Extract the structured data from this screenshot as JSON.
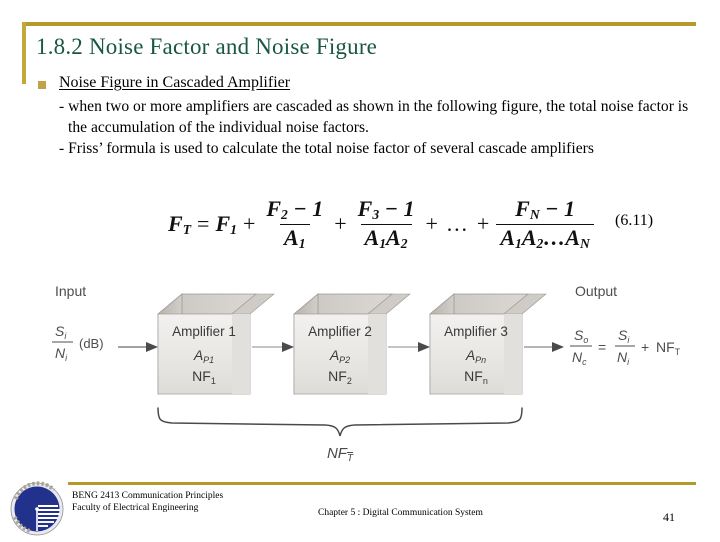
{
  "slide": {
    "title": "1.8.2 Noise Factor and Noise Figure",
    "title_color": "#1a5741",
    "accent_color": "#b5992a",
    "bullet_color": "#c0a24a"
  },
  "bullet": {
    "heading": "Noise Figure in Cascaded Amplifier",
    "paragraphs": [
      "- when two or more amplifiers are cascaded as shown in the following figure, the total noise factor is the accumulation of the individual noise factors.",
      "- Friss’ formula is used to calculate the total noise factor of several cascade amplifiers"
    ]
  },
  "equation": {
    "lhs": "F",
    "lhs_sub": "T",
    "equals": "=",
    "term1": "F",
    "term1_sub": "1",
    "plus": "+",
    "frac1_num_f": "F",
    "frac1_num_sub": "2",
    "frac1_num_tail": "− 1",
    "frac1_den_a": "A",
    "frac1_den_sub": "1",
    "frac2_num_f": "F",
    "frac2_num_sub": "3",
    "frac2_num_tail": "− 1",
    "frac2_den_a1": "A",
    "frac2_den_sub1": "1",
    "frac2_den_a2": "A",
    "frac2_den_sub2": "2",
    "ellipsis": "…",
    "frac3_num_f": "F",
    "frac3_num_sub": "N",
    "frac3_num_tail": "− 1",
    "frac3_den_a1": "A",
    "frac3_den_sub1": "1",
    "frac3_den_a2": "A",
    "frac3_den_sub2": "2",
    "frac3_den_dots": "…",
    "frac3_den_a3": "A",
    "frac3_den_sub3": "N",
    "number": "(6.11)"
  },
  "figure": {
    "input_label": "Input",
    "output_label": "Output",
    "input_ratio_num": "S",
    "input_ratio_num_sub": "i",
    "input_ratio_den": "N",
    "input_ratio_den_sub": "i",
    "input_unit": "(dB)",
    "blocks": [
      {
        "name": "Amplifier 1",
        "gain": "A",
        "gain_sub": "P1",
        "nf": "NF",
        "nf_sub": "1"
      },
      {
        "name": "Amplifier 2",
        "gain": "A",
        "gain_sub": "P2",
        "nf": "NF",
        "nf_sub": "2"
      },
      {
        "name": "Amplifier 3",
        "gain": "A",
        "gain_sub": "Pn",
        "nf": "NF",
        "nf_sub": "n"
      }
    ],
    "output_eq": {
      "num1": "S",
      "num1_sub": "o",
      "den1": "N",
      "den1_sub": "c",
      "equals": "=",
      "num2": "S",
      "num2_sub": "i",
      "den2": "N",
      "den2_sub": "i",
      "plus": "+",
      "nf": "NF",
      "nf_sub": "T"
    },
    "brace_label": "NF",
    "brace_label_sub": "T"
  },
  "footer": {
    "line1": "BENG 2413 Communication Principles",
    "line2": "Faculty of Electrical Engineering",
    "center": "Chapter 5 : Digital Communication System",
    "page": "41"
  }
}
